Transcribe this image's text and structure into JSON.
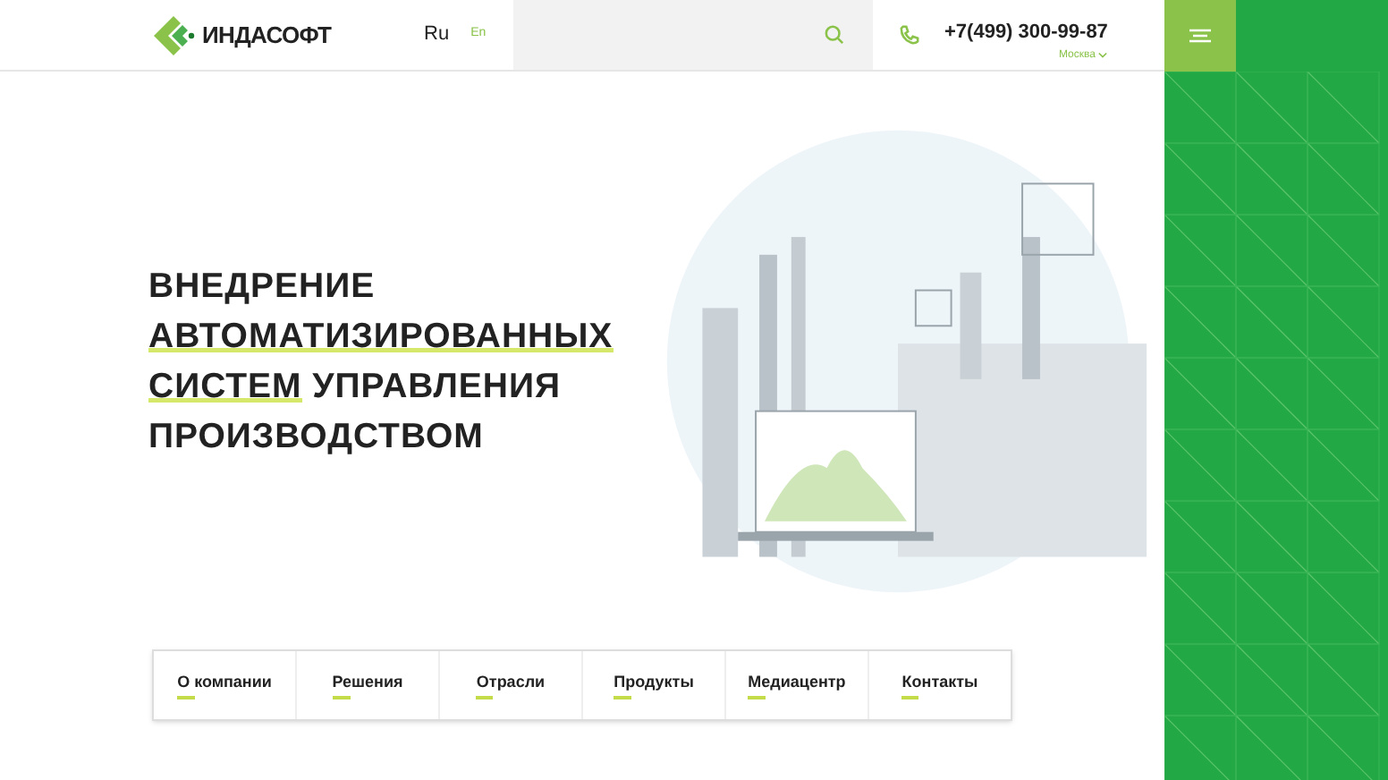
{
  "header": {
    "logo_text": "ИНДАСОФТ",
    "languages": [
      {
        "label": "Ru",
        "selected": true
      },
      {
        "label": "En",
        "selected": false
      }
    ],
    "phone": "+7(499) 300-99-87",
    "city": "Москва"
  },
  "hero": {
    "title_lines": [
      [
        {
          "text": "ВНЕДРЕНИЕ",
          "highlight": false
        }
      ],
      [
        {
          "text": "АВТОМАТИЗИРОВАННЫХ",
          "highlight": true
        }
      ],
      [
        {
          "text": "СИСТЕМ",
          "highlight": true
        },
        {
          "text": " УПРАВЛЕНИЯ",
          "highlight": false
        }
      ],
      [
        {
          "text": "ПРОИЗВОДСТВОМ",
          "highlight": false
        }
      ]
    ]
  },
  "nav": [
    "О компании",
    "Решения",
    "Отрасли",
    "Продукты",
    "Медиацентр",
    "Контакты"
  ]
}
